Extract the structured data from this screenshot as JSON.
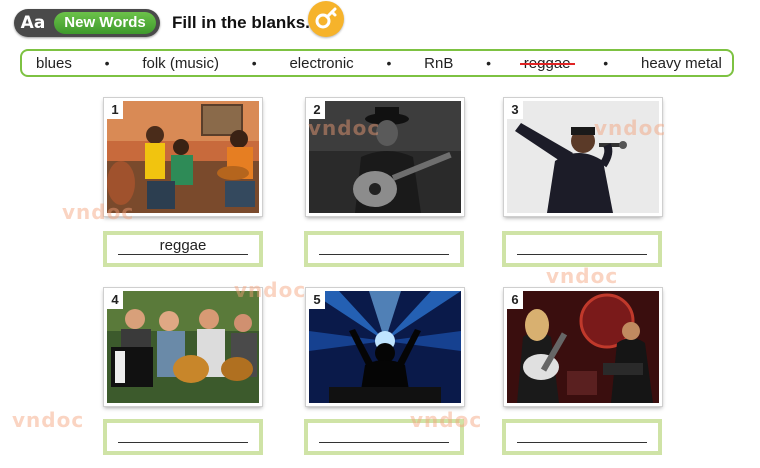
{
  "header": {
    "badge_icon": "Aa",
    "badge_label": "New Words",
    "instruction": "Fill in the blanks.",
    "key_icon": "key-icon"
  },
  "word_box": {
    "words": [
      "blues",
      "folk (music)",
      "electronic",
      "RnB",
      "reggae",
      "heavy metal"
    ],
    "separator": "•",
    "crossed_out": "reggae",
    "border_color": "#7dc242"
  },
  "exercises": [
    {
      "number": "1",
      "photo": "reggae band playing drums and guitar",
      "answer": "reggae"
    },
    {
      "number": "2",
      "photo": "blues guitarist in hat",
      "answer": ""
    },
    {
      "number": "3",
      "photo": "rnb singer with microphone",
      "answer": ""
    },
    {
      "number": "4",
      "photo": "folk band with accordion and guitars",
      "answer": ""
    },
    {
      "number": "5",
      "photo": "dj at electronic concert with lights",
      "answer": ""
    },
    {
      "number": "6",
      "photo": "heavy metal guitarists on stage",
      "answer": ""
    }
  ],
  "watermark": "vndoc",
  "colors": {
    "accent_green": "#4caf32",
    "answer_border": "#cfe3a6",
    "key_orange": "#f6b32b",
    "strike_red": "#e02424"
  }
}
